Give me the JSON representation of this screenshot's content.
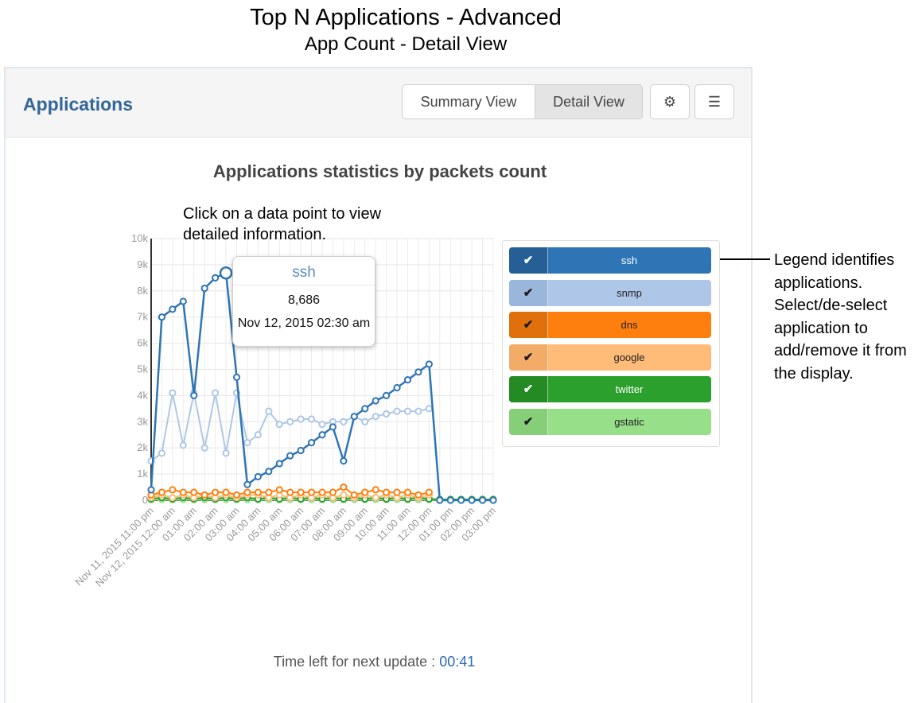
{
  "doc_title": "Top N Applications - Advanced",
  "doc_subtitle": "App Count - Detail View",
  "panel": {
    "title": "Applications",
    "summary_view_label": "Summary View",
    "detail_view_label": "Detail View",
    "active_view": "Detail View",
    "gear_icon": "gear-icon",
    "menu_icon": "menu-icon",
    "gear_glyph": "⚙",
    "menu_glyph": "☰"
  },
  "annotations": {
    "click_hint": "Click on a data point to view detailed information.",
    "legend_note": "Legend identifies applications. Select/de-select application to add/remove it from the display."
  },
  "tooltip": {
    "series": "ssh",
    "value": "8,686",
    "time": "Nov 12, 2015 02:30 am"
  },
  "legend": [
    {
      "name": "ssh",
      "checked": true,
      "check_glyph": "✔",
      "bg": "#2e75b6",
      "check_bg": "#255f96",
      "fg": "#ffffff"
    },
    {
      "name": "snmp",
      "checked": true,
      "check_glyph": "✔",
      "bg": "#aec7e8",
      "check_bg": "#9ab6da",
      "fg": "#222222"
    },
    {
      "name": "dns",
      "checked": true,
      "check_glyph": "✔",
      "bg": "#ff7f0e",
      "check_bg": "#e0700c",
      "fg": "#222222"
    },
    {
      "name": "google",
      "checked": true,
      "check_glyph": "✔",
      "bg": "#ffbb78",
      "check_bg": "#f2ac68",
      "fg": "#222222"
    },
    {
      "name": "twitter",
      "checked": true,
      "check_glyph": "✔",
      "bg": "#2ca02c",
      "check_bg": "#248a24",
      "fg": "#ffffff"
    },
    {
      "name": "gstatic",
      "checked": true,
      "check_glyph": "✔",
      "bg": "#98df8a",
      "check_bg": "#86cf78",
      "fg": "#222222"
    }
  ],
  "footer": {
    "label": "Time left for next update :",
    "timer": "00:41"
  },
  "chart_data": {
    "type": "line",
    "title": "Applications statistics by packets count",
    "ylim": [
      0,
      10000
    ],
    "y_ticks": [
      "0",
      "1k",
      "2k",
      "3k",
      "4k",
      "5k",
      "6k",
      "7k",
      "8k",
      "9k",
      "10k"
    ],
    "x_tick_labels": [
      "Nov 11, 2015 11:00 pm",
      "Nov 12, 2015 12:00 am",
      "01:00 am",
      "02:00 am",
      "03:00 am",
      "04:00 am",
      "05:00 am",
      "06:00 am",
      "07:00 am",
      "08:00 am",
      "09:00 am",
      "10:00 am",
      "11:00 am",
      "12:00 pm",
      "01:00 pm",
      "02:00 pm",
      "03:00 pm"
    ],
    "grid": true,
    "series": [
      {
        "name": "ssh",
        "color": "#2e75b6",
        "x": [
          0,
          0.5,
          1,
          1.5,
          2,
          2.5,
          3,
          3.5,
          4,
          4.5,
          5,
          5.5,
          6,
          6.5,
          7,
          7.5,
          8,
          8.5,
          9,
          9.5,
          10,
          10.5,
          11,
          11.5,
          12,
          12.5,
          13,
          13.5,
          14,
          14.5,
          15,
          15.5,
          16
        ],
        "values": [
          400,
          7000,
          7300,
          7600,
          4000,
          8100,
          8500,
          8686,
          4700,
          600,
          900,
          1100,
          1400,
          1700,
          1900,
          2200,
          2500,
          2800,
          1500,
          3200,
          3500,
          3800,
          4000,
          4300,
          4600,
          4900,
          5200,
          0,
          0,
          0,
          0,
          0,
          0
        ]
      },
      {
        "name": "snmp",
        "color": "#aec7e8",
        "x": [
          0,
          0.5,
          1,
          1.5,
          2,
          2.5,
          3,
          3.5,
          4,
          4.5,
          5,
          5.5,
          6,
          6.5,
          7,
          7.5,
          8,
          8.5,
          9,
          9.5,
          10,
          10.5,
          11,
          11.5,
          12,
          12.5,
          13
        ],
        "values": [
          1500,
          1800,
          4100,
          2100,
          4100,
          2000,
          4100,
          1800,
          4100,
          2200,
          2500,
          3400,
          2900,
          3000,
          3100,
          3100,
          2900,
          3000,
          3000,
          3200,
          3000,
          3200,
          3300,
          3400,
          3400,
          3400,
          3500
        ]
      },
      {
        "name": "dns",
        "color": "#ff7f0e",
        "x": [
          0,
          0.5,
          1,
          1.5,
          2,
          2.5,
          3,
          3.5,
          4,
          4.5,
          5,
          5.5,
          6,
          6.5,
          7,
          7.5,
          8,
          8.5,
          9,
          9.5,
          10,
          10.5,
          11,
          11.5,
          12,
          12.5,
          13
        ],
        "values": [
          200,
          300,
          400,
          300,
          300,
          200,
          300,
          300,
          200,
          300,
          300,
          300,
          400,
          300,
          300,
          300,
          300,
          300,
          500,
          200,
          300,
          400,
          300,
          300,
          300,
          200,
          300
        ]
      },
      {
        "name": "google",
        "color": "#ffbb78",
        "x": [
          0,
          0.5,
          1,
          1.5,
          2,
          2.5,
          3,
          3.5,
          4,
          4.5,
          5,
          5.5,
          6,
          6.5,
          7,
          7.5,
          8,
          8.5,
          9,
          9.5,
          10,
          10.5,
          11,
          11.5,
          12,
          12.5,
          13
        ],
        "values": [
          100,
          200,
          100,
          200,
          100,
          200,
          100,
          200,
          100,
          200,
          200,
          100,
          200,
          100,
          200,
          100,
          200,
          100,
          200,
          100,
          200,
          100,
          200,
          100,
          200,
          100,
          200
        ]
      },
      {
        "name": "twitter",
        "color": "#2ca02c",
        "x": [
          0,
          0.5,
          1,
          1.5,
          2,
          2.5,
          3,
          3.5,
          4,
          4.5,
          5,
          5.5,
          6,
          6.5,
          7,
          7.5,
          8,
          8.5,
          9,
          9.5,
          10,
          10.5,
          11,
          11.5,
          12,
          12.5,
          13,
          13.5,
          14,
          14.5,
          15,
          15.5,
          16
        ],
        "values": [
          50,
          100,
          50,
          100,
          50,
          100,
          50,
          100,
          50,
          100,
          50,
          100,
          50,
          100,
          50,
          100,
          50,
          100,
          50,
          100,
          50,
          100,
          50,
          100,
          50,
          100,
          50,
          30,
          30,
          30,
          30,
          30,
          30
        ]
      },
      {
        "name": "gstatic",
        "color": "#98df8a",
        "x": [
          0,
          0.5,
          1,
          1.5,
          2,
          2.5,
          3,
          3.5,
          4,
          4.5,
          5,
          5.5,
          6,
          6.5,
          7,
          7.5,
          8,
          8.5,
          9,
          9.5,
          10,
          10.5,
          11,
          11.5,
          12,
          12.5,
          13,
          13.5,
          14,
          14.5,
          15,
          15.5,
          16
        ],
        "values": [
          20,
          30,
          20,
          30,
          20,
          30,
          20,
          30,
          20,
          30,
          20,
          30,
          20,
          30,
          20,
          30,
          20,
          30,
          20,
          30,
          20,
          30,
          20,
          30,
          20,
          30,
          20,
          20,
          20,
          20,
          20,
          20,
          20
        ]
      }
    ]
  }
}
